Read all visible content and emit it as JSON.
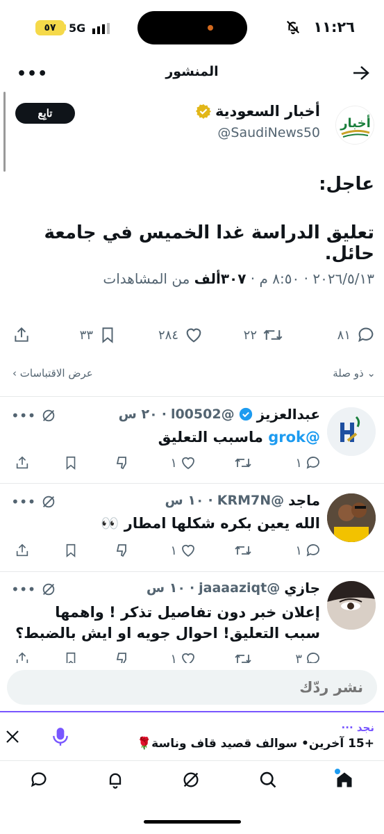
{
  "status": {
    "time": "١١:٢٦",
    "battery": "٥٧",
    "network": "5G"
  },
  "header": {
    "title": "المنشور"
  },
  "tweet": {
    "author_name": "أخبار السعودية",
    "handle": "@SaudiNews50",
    "follow_label": "تابِع",
    "line1": "عاجل:",
    "line2": "تعليق الدراسة غدا الخميس في جامعة حائل.",
    "date": "٢٠٢٦/٥/١٣",
    "time": "٨:٥٠ م",
    "views_count": "٣٠٧ألف",
    "views_label": "من المشاهدات",
    "replies": "٨١",
    "retweets": "٢٢",
    "likes": "٢٨٤",
    "bookmarks": "٣٣"
  },
  "filters": {
    "relevance": "ذو صلة",
    "quotes": "عرض الاقتباسات"
  },
  "replies": [
    {
      "name": "عبدالعزيز",
      "handle": "@l00502",
      "time": "٢٠ س",
      "mention": "@grok",
      "text": "ماسبب التعليق",
      "replies": "١",
      "likes": "١"
    },
    {
      "name": "ماجد",
      "handle": "@KRM7N",
      "time": "١٠ س",
      "text": "الله يعين بكره شكلها امطار 👀",
      "replies": "١",
      "likes": "١"
    },
    {
      "name": "جازي",
      "handle": "@jaaaaziqt",
      "time": "١٠ س",
      "text": "إعلان خبر دون تفاصيل تذكر ! واهمها سبب التعليق! احوال جويه او ايش بالضبط؟",
      "replies": "٣",
      "likes": "١"
    }
  ],
  "reply_bar": {
    "placeholder": "نشر ردّك"
  },
  "space": {
    "location": "نجد",
    "title": "+15 آخرين• سوالف قصيد قاف وناسة🌹"
  },
  "colors": {
    "accent": "#1d9bf0",
    "space_purple": "#7856ff",
    "verified_gold": "#e2b719",
    "text": "#0f1419",
    "muted": "#536471"
  }
}
